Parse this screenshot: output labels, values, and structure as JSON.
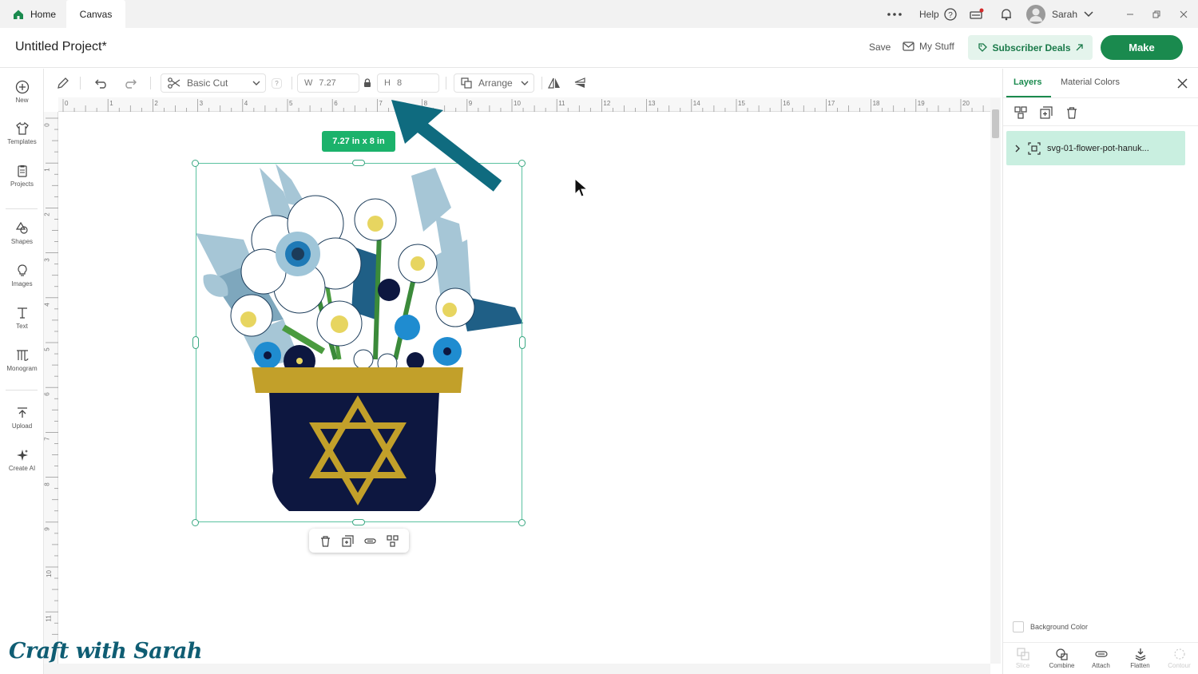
{
  "tabs": {
    "home": "Home",
    "canvas": "Canvas"
  },
  "topbar": {
    "help": "Help",
    "user": "Sarah"
  },
  "header": {
    "project_title": "Untitled Project*",
    "save": "Save",
    "my_stuff": "My Stuff",
    "subscriber_deals": "Subscriber Deals",
    "make": "Make"
  },
  "toolbar": {
    "operation": "Basic Cut",
    "help_q": "?",
    "width_label": "W",
    "width_value": "7.27",
    "height_label": "H",
    "height_value": "8",
    "arrange": "Arrange"
  },
  "leftnav": [
    {
      "label": "New",
      "icon": "plus-circle-icon"
    },
    {
      "label": "Templates",
      "icon": "shirt-icon"
    },
    {
      "label": "Projects",
      "icon": "clipboard-icon"
    },
    {
      "label": "Shapes",
      "icon": "shapes-icon"
    },
    {
      "label": "Images",
      "icon": "lightbulb-icon"
    },
    {
      "label": "Text",
      "icon": "text-icon"
    },
    {
      "label": "Monogram",
      "icon": "monogram-icon"
    },
    {
      "label": "Upload",
      "icon": "upload-icon"
    },
    {
      "label": "Create AI",
      "icon": "sparkle-icon"
    }
  ],
  "ruler": {
    "top": [
      "0",
      "1",
      "2",
      "3",
      "4",
      "5",
      "6",
      "7",
      "8",
      "9",
      "10",
      "11",
      "12",
      "13",
      "14",
      "15",
      "16",
      "17",
      "18",
      "19",
      "20"
    ],
    "left": [
      "0",
      "1",
      "2",
      "3",
      "4",
      "5",
      "6",
      "7",
      "8",
      "9",
      "10",
      "11"
    ]
  },
  "selection": {
    "size_label": "7.27  in x 8  in"
  },
  "panel": {
    "tab_layers": "Layers",
    "tab_material_colors": "Material Colors",
    "layer_name": "svg-01-flower-pot-hanuk...",
    "background_color": "Background Color",
    "actions": [
      {
        "label": "Slice",
        "enabled": false
      },
      {
        "label": "Combine",
        "enabled": true
      },
      {
        "label": "Attach",
        "enabled": true
      },
      {
        "label": "Flatten",
        "enabled": true
      },
      {
        "label": "Contour",
        "enabled": false
      }
    ]
  },
  "colors": {
    "accent_green": "#1a8a4e",
    "selection_green": "#1bb26b",
    "arrow_teal": "#0f6b7f",
    "pot_navy": "#0d1740",
    "pot_gold": "#c2a02a"
  },
  "watermark": "Craft with Sarah"
}
